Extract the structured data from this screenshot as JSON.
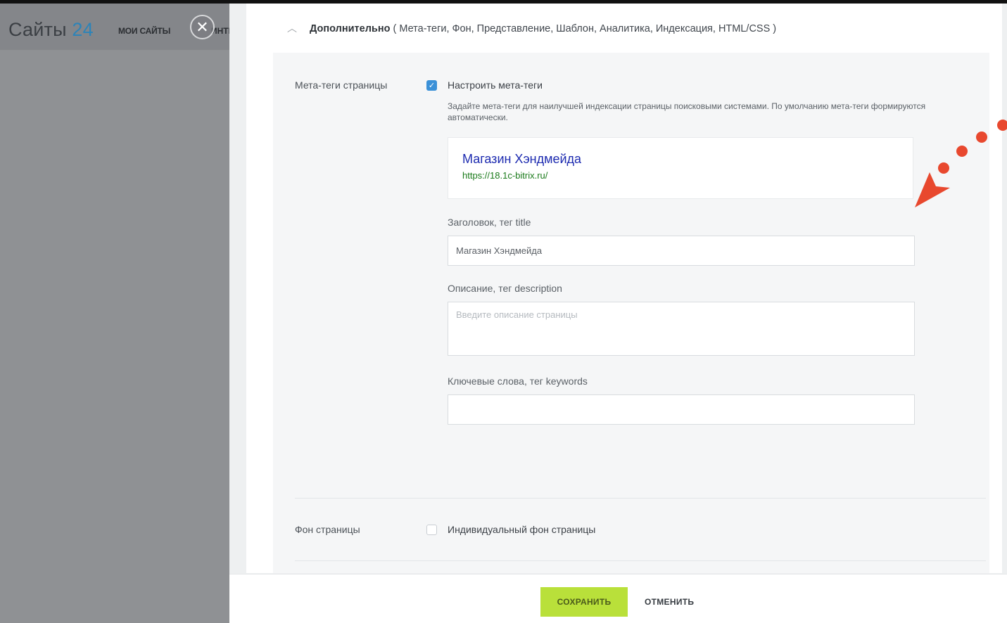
{
  "app": {
    "logo_main": "Сайты",
    "logo_num": "24",
    "nav_my_sites": "МОИ САЙТЫ",
    "nav_interactive": "ИНТЕ"
  },
  "section": {
    "toggle_label": "Дополнительно",
    "items_text": "( Мета-теги,  Фон,  Представление,  Шаблон,  Аналитика,  Индексация,  HTML/CSS )"
  },
  "meta": {
    "row_label": "Мета-теги страницы",
    "checkbox_label": "Настроить мета-теги",
    "checkbox_checked": true,
    "hint": "Задайте мета-теги для наилучшей индексации страницы поисковыми системами. По умолчанию мета-теги формируются автоматически.",
    "preview_title": "Магазин Хэндмейда",
    "preview_url": "https://18.1c-bitrix.ru/",
    "title_label": "Заголовок, тег title",
    "title_value": "Магазин Хэндмейда",
    "description_label": "Описание, тег description",
    "description_placeholder": "Введите описание страницы",
    "keywords_label": "Ключевые слова, тег keywords",
    "keywords_value": ""
  },
  "background": {
    "row_label": "Фон страницы",
    "checkbox_label": "Индивидуальный фон страницы",
    "checkbox_checked": false
  },
  "footer": {
    "save_label": "СОХРАНИТЬ",
    "cancel_label": "ОТМЕНИТЬ"
  },
  "colors": {
    "accent_blue": "#3b91d8",
    "save_green": "#b9e03a",
    "annotation_red": "#e8482e",
    "preview_title": "#1d2bb0",
    "preview_url": "#1a7a1a"
  }
}
